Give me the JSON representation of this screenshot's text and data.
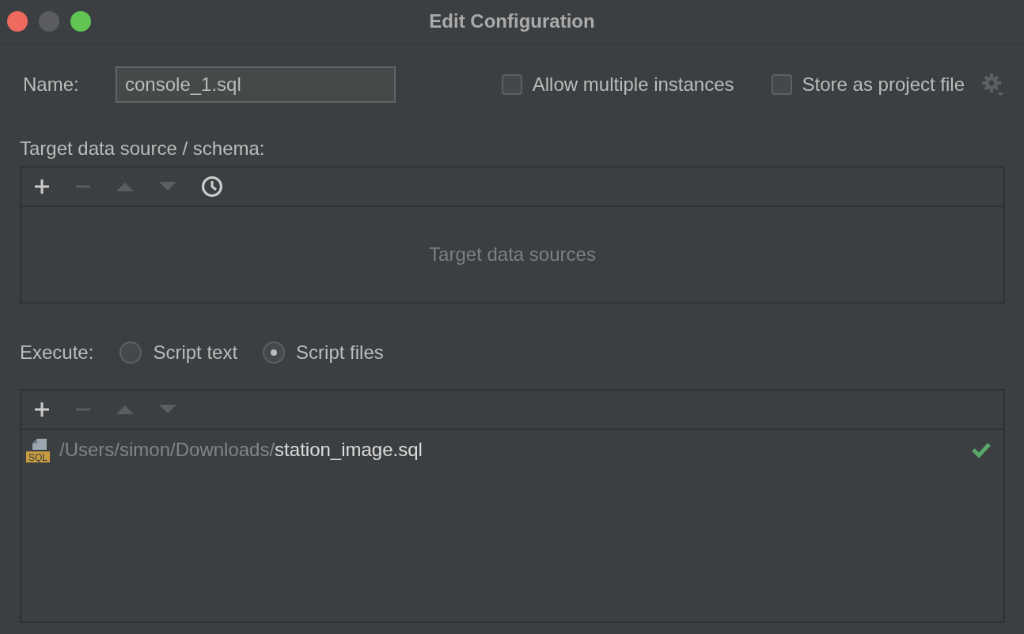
{
  "window": {
    "title": "Edit Configuration"
  },
  "name_field": {
    "label": "Name:",
    "value": "console_1.sql"
  },
  "options": [
    {
      "label": "Allow multiple instances",
      "checked": false
    },
    {
      "label": "Store as project file",
      "checked": false
    }
  ],
  "target": {
    "label": "Target data source / schema:",
    "tools": [
      {
        "kind": "add",
        "disabled": false
      },
      {
        "kind": "remove",
        "disabled": true
      },
      {
        "kind": "up",
        "disabled": true
      },
      {
        "kind": "down",
        "disabled": true
      },
      {
        "kind": "history",
        "disabled": false
      }
    ],
    "empty_text": "Target data sources"
  },
  "execute": {
    "label": "Execute:",
    "choices": [
      {
        "label": "Script text",
        "selected": false
      },
      {
        "label": "Script files",
        "selected": true
      }
    ]
  },
  "files": {
    "tools": [
      {
        "kind": "add",
        "disabled": false
      },
      {
        "kind": "remove",
        "disabled": true
      },
      {
        "kind": "up",
        "disabled": true
      },
      {
        "kind": "down",
        "disabled": true
      }
    ],
    "rows": [
      {
        "icon_label": "SQL",
        "directory": "/Users/simon/Downloads/",
        "filename": "station_image.sql",
        "valid": true
      }
    ]
  }
}
